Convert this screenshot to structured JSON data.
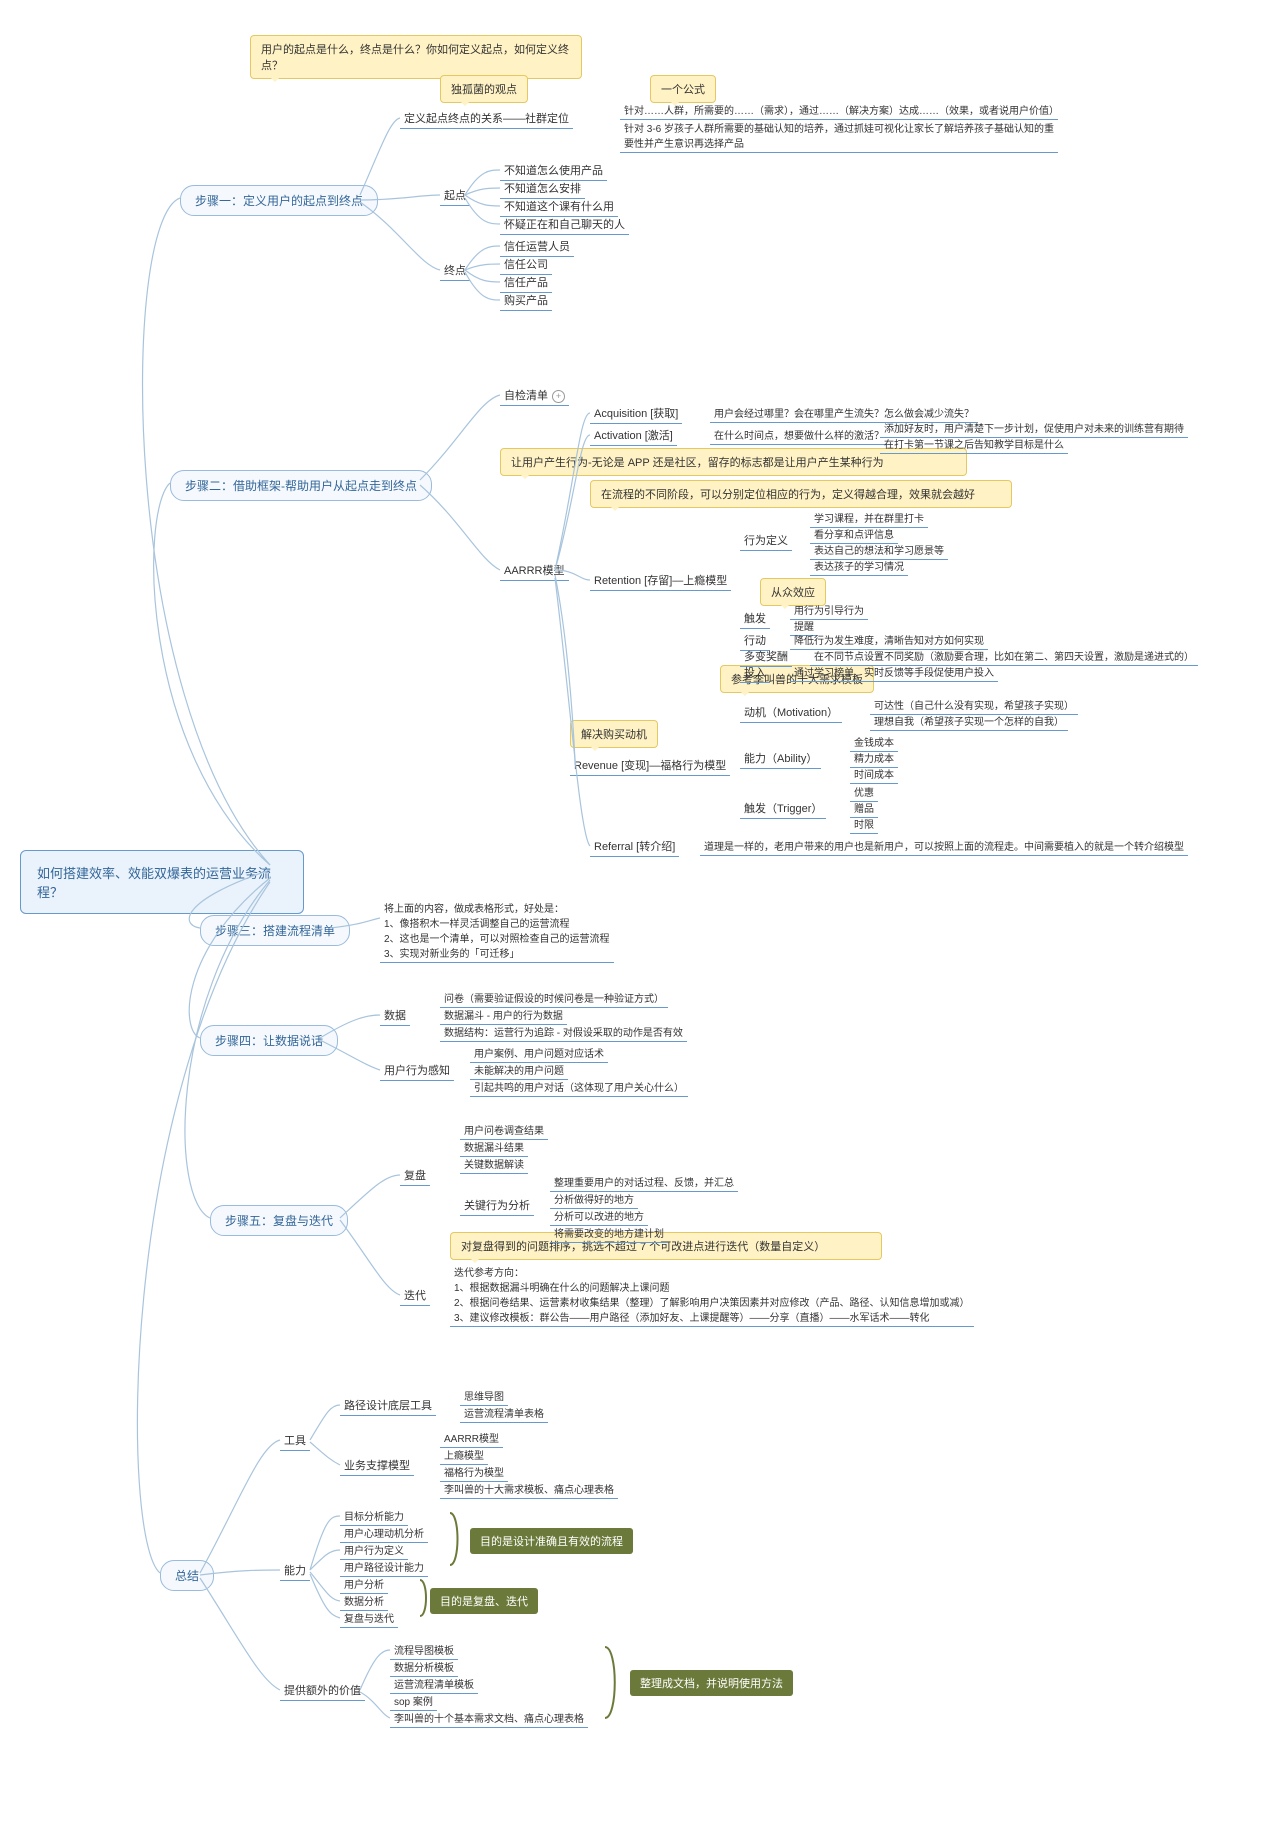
{
  "root": "如何搭建效率、效能双爆表的运营业务流程？",
  "callouts": {
    "c1": "用户的起点是什么，终点是什么？你如何定义起点，如何定义终点？",
    "c2": "独孤菌的观点",
    "c3": "一个公式",
    "c4": "让用户产生行为-无论是 APP 还是社区，留存的标志都是让用户产生某种行为",
    "c5": "在流程的不同阶段，可以分别定位相应的行为，定义得越合理，效果就会越好",
    "c6": "从众效应",
    "c7": "参考李叫兽的十大需求模板",
    "c8": "解决购买动机",
    "c9": "对复盘得到的问题排序，挑选不超过 7 个可改进点进行迭代（数量自定义）"
  },
  "green": {
    "g1": "目的是设计准确且有效的流程",
    "g2": "目的是复盘、迭代",
    "g3": "整理成文档，并说明使用方法"
  },
  "s1": {
    "title": "步骤一：定义用户的起点到终点",
    "rel": "定义起点终点的关系——社群定位",
    "rel_d1": "针对……人群，所需要的……（需求），通过……（解决方案）达成……（效果，或者说用户价值）",
    "rel_d2": "针对 3-6 岁孩子人群所需要的基础认知的培养，通过抓娃可视化让家长了解培养孩子基础认知的重要性并产生意识再选择产品",
    "start": "起点",
    "st1": "不知道怎么使用产品",
    "st2": "不知道怎么安排",
    "st3": "不知道这个课有什么用",
    "st4": "怀疑正在和自己聊天的人",
    "end": "终点",
    "en1": "信任运营人员",
    "en2": "信任公司",
    "en3": "信任产品",
    "en4": "购买产品"
  },
  "s2": {
    "title": "步骤二：借助框架-帮助用户从起点走到终点",
    "check": "自检清单",
    "model": "AARRR模型",
    "acq": "Acquisition [获取]",
    "acq_d": "用户会经过哪里？会在哪里产生流失？怎么做会减少流失？",
    "act": "Activation [激活]",
    "act_d": "在什么时间点，想要做什么样的激活？",
    "act_d1": "添加好友时，用户清楚下一步计划，促使用户对未来的训练营有期待",
    "act_d2": "在打卡第一节课之后告知教学目标是什么",
    "ret": "Retention [存留]—上瘾模型",
    "beh": "行为定义",
    "beh1": "学习课程，并在群里打卡",
    "beh2": "看分享和点评信息",
    "beh3": "表达自己的想法和学习愿景等",
    "beh4": "表达孩子的学习情况",
    "trig": "触发",
    "trig1": "用行为引导行为",
    "trig2": "提醒",
    "action": "行动",
    "action_d": "降低行为发生难度，清晰告知对方如何实现",
    "reward": "多变奖酬",
    "reward_d": "在不同节点设置不同奖励（激励要合理，比如在第二、第四天设置，激励是递进式的）",
    "invest": "投入",
    "invest_d": "通过学习榜单、实时反馈等手段促使用户投入",
    "rev": "Revenue [变现]—福格行为模型",
    "mot": "动机（Motivation）",
    "mot1": "可达性（自己什么没有实现，希望孩子实现）",
    "mot2": "理想自我（希望孩子实现一个怎样的自我）",
    "abi": "能力（Ability）",
    "abi1": "金钱成本",
    "abi2": "精力成本",
    "abi3": "时间成本",
    "trg": "触发（Trigger）",
    "trg1": "优惠",
    "trg2": "赠品",
    "trg3": "时限",
    "ref": "Referral [转介绍]",
    "ref_d": "道理是一样的，老用户带来的用户也是新用户，可以按照上面的流程走。中间需要植入的就是一个转介绍模型"
  },
  "s3": {
    "title": "步骤三：搭建流程清单",
    "desc": "将上面的内容，做成表格形式，好处是：\n1、像搭积木一样灵活调整自己的运营流程\n2、这也是一个清单，可以对照检查自己的运营流程\n3、实现对新业务的「可迁移」"
  },
  "s4": {
    "title": "步骤四：让数据说话",
    "data": "数据",
    "d1": "问卷（需要验证假设的时候问卷是一种验证方式）",
    "d2": "数据漏斗 - 用户的行为数据",
    "d3": "数据结构：运营行为追踪 - 对假设采取的动作是否有效",
    "sense": "用户行为感知",
    "u1": "用户案例、用户问题对应话术",
    "u2": "未能解决的用户问题",
    "u3": "引起共鸣的用户对话（这体现了用户关心什么）"
  },
  "s5": {
    "title": "步骤五：复盘与迭代",
    "review": "复盘",
    "r1": "用户问卷调查结果",
    "r2": "数据漏斗结果",
    "r3": "关键数据解读",
    "rb": "关键行为分析",
    "rb1": "整理重要用户的对话过程、反馈，并汇总",
    "rb2": "分析做得好的地方",
    "rb3": "分析可以改进的地方",
    "rb4": "将需要改变的地方建计划",
    "iter": "迭代",
    "iter_d": "迭代参考方向：\n1、根据数据漏斗明确在什么的问题解决上课问题\n2、根据问卷结果、运营素材收集结果（整理）了解影响用户决策因素并对应修改（产品、路径、认知信息增加或减）\n3、建议修改模板：群公告——用户路径（添加好友、上课提醒等）——分享（直播）——水军话术——转化"
  },
  "sm": {
    "title": "总结",
    "tools": "工具",
    "t1": "路径设计底层工具",
    "t1a": "思维导图",
    "t1b": "运营流程清单表格",
    "t2": "业务支撑模型",
    "t2a": "AARRR模型",
    "t2b": "上瘾模型",
    "t2c": "福格行为模型",
    "t2d": "李叫兽的十大需求模板、痛点心理表格",
    "ability": "能力",
    "a1": "目标分析能力",
    "a2": "用户心理动机分析",
    "a3": "用户行为定义",
    "a4": "用户路径设计能力",
    "a5": "用户分析",
    "a6": "数据分析",
    "a7": "复盘与迭代",
    "extra": "提供额外的价值",
    "e1": "流程导图模板",
    "e2": "数据分析模板",
    "e3": "运营流程清单模板",
    "e4": "sop 案例",
    "e5": "李叫兽的十个基本需求文档、痛点心理表格"
  }
}
